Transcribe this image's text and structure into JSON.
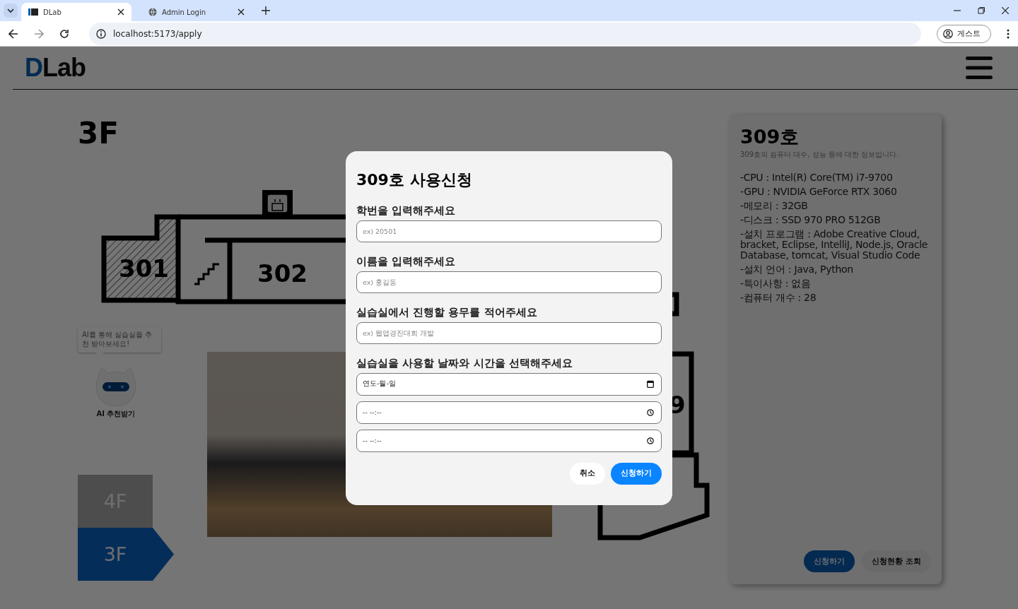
{
  "browser": {
    "tabs": [
      {
        "title": "DLab",
        "selected": true
      },
      {
        "title": "Admin Login",
        "selected": false
      }
    ],
    "address": "localhost:5173/apply",
    "profile": "게스트"
  },
  "header": {
    "logo": "DLab"
  },
  "floor_title": "3F",
  "floor_plan": {
    "rooms": [
      "301",
      "302",
      "9"
    ]
  },
  "ai_recommend": {
    "bubble": "AI를 통해 실습실을 추천 받아보세요!",
    "label": "AI 추천받기"
  },
  "floors": [
    {
      "label": "4F",
      "selected": false
    },
    {
      "label": "3F",
      "selected": true
    }
  ],
  "room_panel": {
    "title": "309호",
    "subtitle": "309호의 컴퓨터 대수, 성능 등에 대한 정보입니다.",
    "specs": [
      "-CPU : Intel(R) Core(TM) i7-9700",
      "-GPU : NVIDIA GeForce RTX 3060",
      "-메모리 : 32GB",
      "-디스크 : SSD 970 PRO 512GB",
      "-설치 프로그램 : Adobe Creative Cloud, bracket, Eclipse, IntelliJ, Node.js, Oracle Database, tomcat, Visual Studio Code",
      "-설치 언어 : Java, Python",
      "-특이사항 : 없음",
      "-컴퓨터 개수 : 28"
    ],
    "buttons": [
      {
        "label": "신청하기",
        "kind": "primary"
      },
      {
        "label": "신청현황 조회",
        "kind": "secondary"
      }
    ]
  },
  "modal": {
    "title": "309호 사용신청",
    "fields": [
      {
        "label": "학번을 입력해주세요",
        "placeholder": "ex) 20501"
      },
      {
        "label": "이름을 입력해주세요",
        "placeholder": "ex) 홍길동"
      },
      {
        "label": "실습실에서 진행할 용무를 적어주세요",
        "placeholder": "ex) 웹앱경진대회 개발"
      }
    ],
    "schedule": {
      "label": "실습실을 사용할 날짜와 시간을 선택해주세요",
      "inputs": [
        {
          "kind": "date",
          "text": "연도-월-일"
        },
        {
          "kind": "time",
          "text": "-- --:--"
        },
        {
          "kind": "time",
          "text": "-- --:--"
        }
      ]
    },
    "buttons": [
      {
        "label": "취소",
        "kind": "secondary"
      },
      {
        "label": "신청하기",
        "kind": "primary"
      }
    ]
  }
}
